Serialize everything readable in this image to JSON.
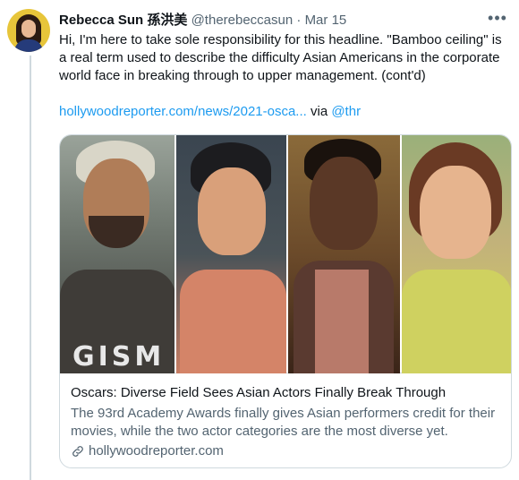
{
  "tweet": {
    "display_name": "Rebecca Sun",
    "display_name_cjk": "孫洪美",
    "handle": "@therebeccasun",
    "separator": "·",
    "date": "Mar 15",
    "text": "Hi, I'm here to take sole responsibility for this headline. \"Bamboo ceiling\" is a real term used to describe the difficulty Asian Americans in the corporate world face in breaking through to upper management. (cont'd)",
    "link_text": "hollywoodreporter.com/news/2021-osca...",
    "via_text": " via ",
    "via_handle": "@thr"
  },
  "card": {
    "title": "Oscars: Diverse Field Sees Asian Actors Finally Break Through",
    "description": "The 93rd Academy Awards finally gives Asian performers credit for their movies, while the two actor categories are the most diverse yet.",
    "domain": "hollywoodreporter.com",
    "shirt_text": "GISM"
  },
  "colors": {
    "accent": "#1d9bf0",
    "secondary_text": "#536471",
    "border": "#cfd9de"
  },
  "icons": {
    "more": "more-horizontal-icon",
    "link": "link-icon"
  }
}
